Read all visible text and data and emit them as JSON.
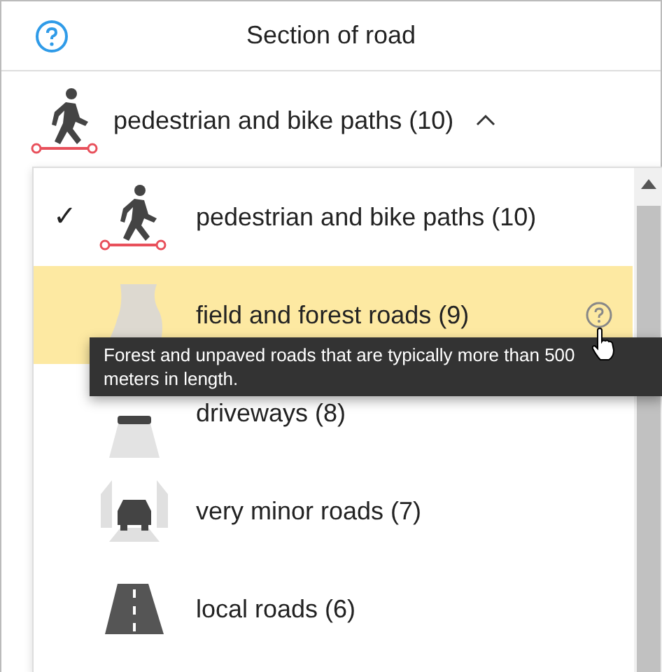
{
  "header": {
    "title": "Section of road"
  },
  "selector": {
    "label": "pedestrian and bike paths (10)",
    "expanded": true
  },
  "options": [
    {
      "kind": "path",
      "label": "pedestrian and bike paths (10)",
      "selected": true,
      "highlighted": false
    },
    {
      "kind": "track",
      "label": "field and forest roads (9)",
      "selected": false,
      "highlighted": true,
      "help": true
    },
    {
      "kind": "driveway",
      "label": "driveways (8)",
      "selected": false,
      "highlighted": false
    },
    {
      "kind": "minor",
      "label": "very minor roads (7)",
      "selected": false,
      "highlighted": false
    },
    {
      "kind": "local",
      "label": "local roads (6)",
      "selected": false,
      "highlighted": false
    }
  ],
  "tooltip": {
    "text": "Forest and unpaved roads that are typically more than 500 meters in length."
  },
  "check_mark": "✓"
}
